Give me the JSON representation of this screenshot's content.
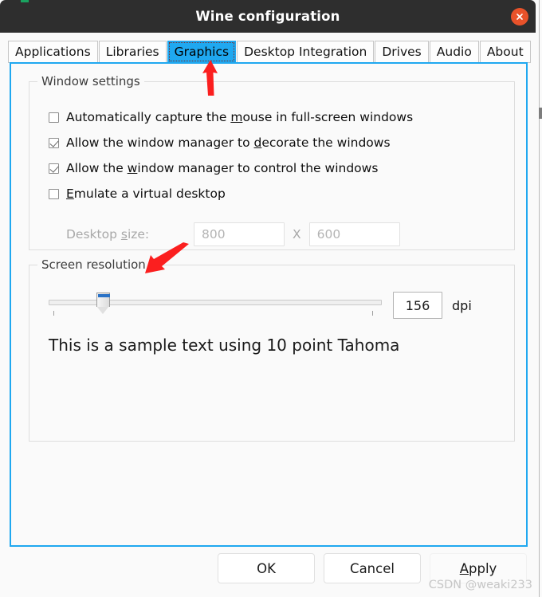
{
  "window": {
    "title": "Wine configuration",
    "close_icon": "close-icon"
  },
  "tabs": [
    {
      "label": "Applications",
      "selected": false
    },
    {
      "label": "Libraries",
      "selected": false
    },
    {
      "label": "Graphics",
      "selected": true
    },
    {
      "label": "Desktop Integration",
      "selected": false
    },
    {
      "label": "Drives",
      "selected": false
    },
    {
      "label": "Audio",
      "selected": false
    },
    {
      "label": "About",
      "selected": false
    }
  ],
  "window_settings": {
    "group_label": "Window settings",
    "checkboxes": [
      {
        "pre": "Automatically capture the ",
        "accel": "m",
        "post": "ouse in full-screen windows",
        "checked": false
      },
      {
        "pre": "Allow the window manager to ",
        "accel": "d",
        "post": "ecorate the windows",
        "checked": true
      },
      {
        "pre": "Allow the ",
        "accel": "w",
        "post": "indow manager to control the windows",
        "checked": true
      },
      {
        "pre": "",
        "accel": "E",
        "post": "mulate a virtual desktop",
        "checked": false
      }
    ],
    "desktop_size": {
      "label_pre": "Desktop ",
      "label_accel": "s",
      "label_post": "ize:",
      "width_value": "800",
      "separator": "X",
      "height_value": "600",
      "disabled": true
    }
  },
  "screen_resolution": {
    "group_label": "Screen resolution",
    "dpi_value": "156",
    "dpi_unit": "dpi",
    "slider_percent": 15,
    "sample_text": "This is a sample text using 10 point Tahoma"
  },
  "footer": {
    "ok_label": "OK",
    "cancel_label": "Cancel",
    "apply_pre": "",
    "apply_accel": "A",
    "apply_post": "pply"
  },
  "watermark": "CSDN @weaki233",
  "annotations": [
    {
      "name": "arrow-to-graphics-tab",
      "direction": "up"
    },
    {
      "name": "arrow-to-screen-resolution",
      "direction": "down-left"
    }
  ],
  "colors": {
    "titlebar": "#2e2e2e",
    "accent_blue": "#1fa8f0",
    "close_button": "#e8522a",
    "annotation_red": "#fb1f1f",
    "slider_blue": "#2a72c6"
  }
}
